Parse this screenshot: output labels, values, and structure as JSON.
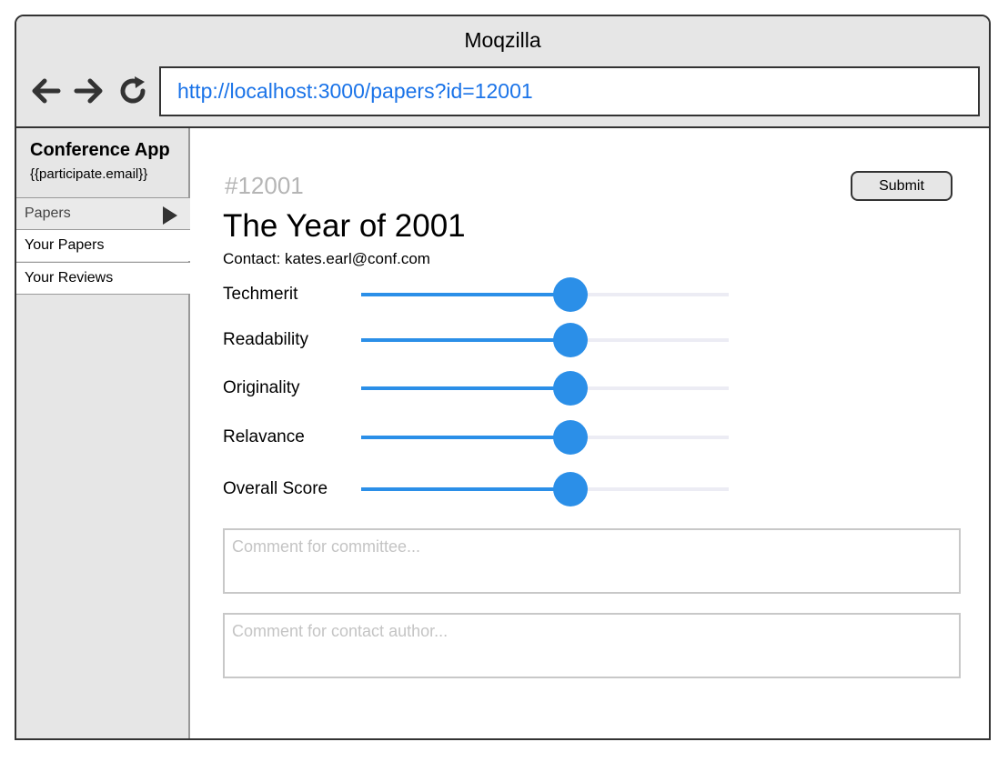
{
  "browser": {
    "title": "Moqzilla",
    "url": "http://localhost:3000/papers?id=12001"
  },
  "sidebar": {
    "app_name": "Conference App",
    "email": "{{participate.email}}",
    "section_label": "Papers",
    "items": [
      {
        "label": "Your Papers"
      },
      {
        "label": "Your Reviews"
      }
    ]
  },
  "paper": {
    "id_label": "#12001",
    "title": "The Year of 2001",
    "contact": "Contact: kates.earl@conf.com"
  },
  "actions": {
    "submit_label": "Submit"
  },
  "scores": [
    {
      "label": "Techmerit",
      "value": 0.57
    },
    {
      "label": "Readability",
      "value": 0.57
    },
    {
      "label": "Originality",
      "value": 0.57
    },
    {
      "label": "Relavance",
      "value": 0.57
    },
    {
      "label": "Overall Score",
      "value": 0.57
    }
  ],
  "comments": {
    "committee_placeholder": "Comment for committee...",
    "author_placeholder": "Comment for contact author..."
  },
  "colors": {
    "accent": "#2b8fe8",
    "url_text": "#1a73e8"
  }
}
